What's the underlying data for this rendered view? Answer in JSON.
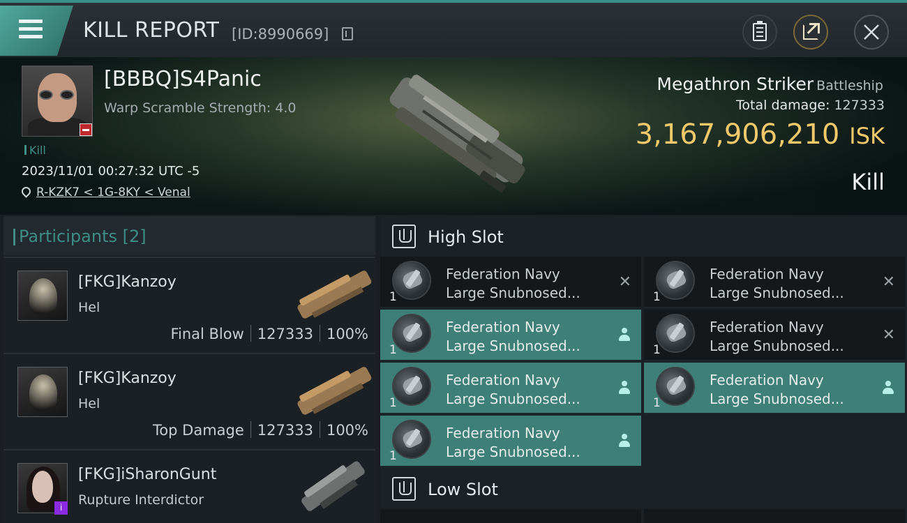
{
  "header": {
    "title": "KILL REPORT",
    "id_label": "[ID:8990669]"
  },
  "victim": {
    "name": "[BBBQ]S4Panic",
    "subtitle": "Warp Scramble Strength: 4.0",
    "tag": "Kill",
    "datetime": "2023/11/01 00:27:32 UTC -5",
    "location": "R-KZK7 < 1G-8KY < Venal"
  },
  "ship": {
    "name": "Megathron Striker",
    "class": "Battleship",
    "total_damage_label": "Total damage:",
    "total_damage": "127333",
    "isk_value": "3,167,906,210",
    "isk_unit": "ISK",
    "result": "Kill"
  },
  "participants": {
    "title": "Participants [2]",
    "rows": [
      {
        "name": "[FKG]Kanzoy",
        "ship": "Hel",
        "role": "Final Blow",
        "damage": "127333",
        "percent": "100%"
      },
      {
        "name": "[FKG]Kanzoy",
        "ship": "Hel",
        "role": "Top Damage",
        "damage": "127333",
        "percent": "100%"
      },
      {
        "name": "[FKG]iSharonGunt",
        "ship": "Rupture Interdictor",
        "badge": "i"
      }
    ]
  },
  "slots": {
    "high": {
      "title": "High Slot",
      "items": [
        {
          "line1": "Federation Navy",
          "line2": "Large Snubnosed...",
          "qty": "1",
          "state": "destroyed"
        },
        {
          "line1": "Federation Navy",
          "line2": "Large Snubnosed...",
          "qty": "1",
          "state": "destroyed"
        },
        {
          "line1": "Federation Navy",
          "line2": "Large Snubnosed...",
          "qty": "1",
          "state": "dropped"
        },
        {
          "line1": "Federation Navy",
          "line2": "Large Snubnosed...",
          "qty": "1",
          "state": "destroyed"
        },
        {
          "line1": "Federation Navy",
          "line2": "Large Snubnosed...",
          "qty": "1",
          "state": "dropped"
        },
        {
          "line1": "Federation Navy",
          "line2": "Large Snubnosed...",
          "qty": "1",
          "state": "dropped"
        },
        {
          "line1": "Federation Navy",
          "line2": "Large Snubnosed...",
          "qty": "1",
          "state": "dropped"
        }
      ]
    },
    "low": {
      "title": "Low Slot"
    }
  },
  "colors": {
    "accent": "#3d8d85",
    "dropped_bg": "#3e7f78",
    "isk": "#f2c96a",
    "badge_red": "#c0272d",
    "badge_purple": "#8a2be2"
  },
  "icons": {
    "menu": "hamburger-icon",
    "copy": "copy-icon",
    "clipboard": "clipboard-icon",
    "share": "share-icon",
    "close": "close-icon",
    "location": "location-pin-icon",
    "slot": "high-slot-icon",
    "dropped": "person-icon",
    "destroyed": "cross-icon"
  }
}
